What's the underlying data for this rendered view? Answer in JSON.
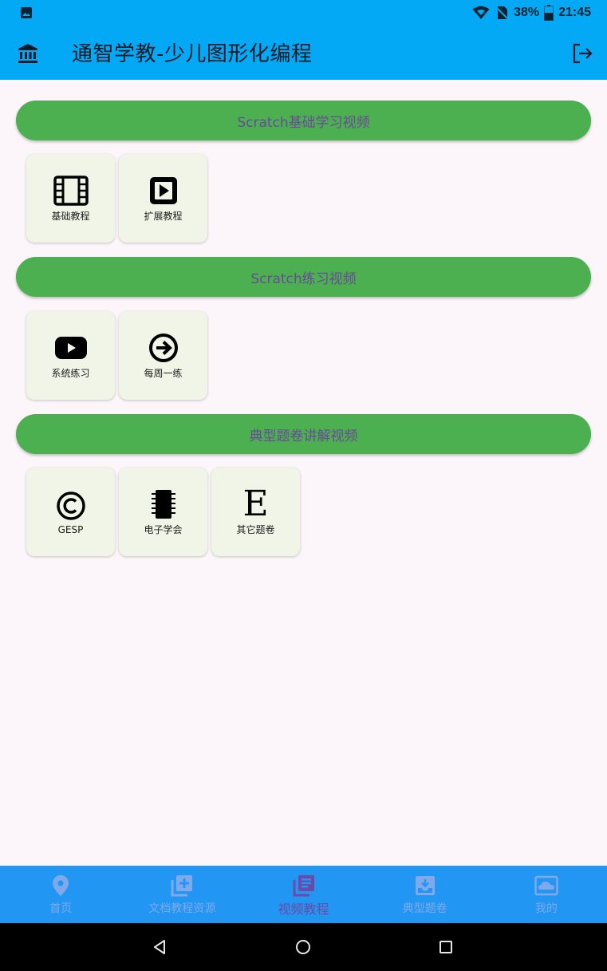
{
  "status_bar": {
    "battery": "38%",
    "time": "21:45"
  },
  "app_bar": {
    "title": "通智学教-少儿图形化编程",
    "leading_icon": "bank-icon",
    "trailing_icon": "logout-icon"
  },
  "sections": [
    {
      "title": "Scratch基础学习视频",
      "tiles": [
        {
          "label": "基础教程",
          "icon": "film-icon"
        },
        {
          "label": "扩展教程",
          "icon": "play-box-icon"
        }
      ]
    },
    {
      "title": "Scratch练习视频",
      "tiles": [
        {
          "label": "系统练习",
          "icon": "youtube-icon"
        },
        {
          "label": "每周一练",
          "icon": "arrow-circle-right-icon"
        }
      ]
    },
    {
      "title": "典型题卷讲解视频",
      "tiles": [
        {
          "label": "GESP",
          "icon": "copyright-icon"
        },
        {
          "label": "电子学会",
          "icon": "chip-icon"
        },
        {
          "label": "其它题卷",
          "icon": "letter-e-icon",
          "glyph": "E"
        }
      ]
    }
  ],
  "bottom_nav": [
    {
      "label": "首页",
      "icon": "location-pin-icon",
      "active": false
    },
    {
      "label": "文档教程资源",
      "icon": "library-add-icon",
      "active": false
    },
    {
      "label": "视频教程",
      "icon": "library-books-icon",
      "active": true
    },
    {
      "label": "典型题卷",
      "icon": "move-to-inbox-icon",
      "active": false
    },
    {
      "label": "我的",
      "icon": "cloud-box-icon",
      "active": false
    }
  ],
  "colors": {
    "app_bar": "#03a9f4",
    "section_button": "#4caf50",
    "section_text": "#6a4a9a",
    "tile_bg": "#f1f5e7",
    "bottom_nav": "#2196f3",
    "nav_inactive": "#7fa9ea",
    "nav_active": "#6d4aa7",
    "page_bg": "#fcf6fb"
  }
}
